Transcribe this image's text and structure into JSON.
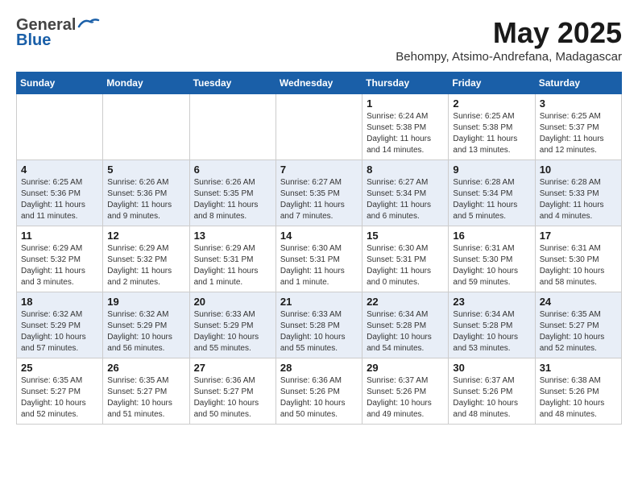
{
  "header": {
    "logo_general": "General",
    "logo_blue": "Blue",
    "month": "May 2025",
    "subtitle": "Behompy, Atsimo-Andrefana, Madagascar"
  },
  "weekdays": [
    "Sunday",
    "Monday",
    "Tuesday",
    "Wednesday",
    "Thursday",
    "Friday",
    "Saturday"
  ],
  "weeks": [
    [
      {
        "day": "",
        "info": ""
      },
      {
        "day": "",
        "info": ""
      },
      {
        "day": "",
        "info": ""
      },
      {
        "day": "",
        "info": ""
      },
      {
        "day": "1",
        "info": "Sunrise: 6:24 AM\nSunset: 5:38 PM\nDaylight: 11 hours\nand 14 minutes."
      },
      {
        "day": "2",
        "info": "Sunrise: 6:25 AM\nSunset: 5:38 PM\nDaylight: 11 hours\nand 13 minutes."
      },
      {
        "day": "3",
        "info": "Sunrise: 6:25 AM\nSunset: 5:37 PM\nDaylight: 11 hours\nand 12 minutes."
      }
    ],
    [
      {
        "day": "4",
        "info": "Sunrise: 6:25 AM\nSunset: 5:36 PM\nDaylight: 11 hours\nand 11 minutes."
      },
      {
        "day": "5",
        "info": "Sunrise: 6:26 AM\nSunset: 5:36 PM\nDaylight: 11 hours\nand 9 minutes."
      },
      {
        "day": "6",
        "info": "Sunrise: 6:26 AM\nSunset: 5:35 PM\nDaylight: 11 hours\nand 8 minutes."
      },
      {
        "day": "7",
        "info": "Sunrise: 6:27 AM\nSunset: 5:35 PM\nDaylight: 11 hours\nand 7 minutes."
      },
      {
        "day": "8",
        "info": "Sunrise: 6:27 AM\nSunset: 5:34 PM\nDaylight: 11 hours\nand 6 minutes."
      },
      {
        "day": "9",
        "info": "Sunrise: 6:28 AM\nSunset: 5:34 PM\nDaylight: 11 hours\nand 5 minutes."
      },
      {
        "day": "10",
        "info": "Sunrise: 6:28 AM\nSunset: 5:33 PM\nDaylight: 11 hours\nand 4 minutes."
      }
    ],
    [
      {
        "day": "11",
        "info": "Sunrise: 6:29 AM\nSunset: 5:32 PM\nDaylight: 11 hours\nand 3 minutes."
      },
      {
        "day": "12",
        "info": "Sunrise: 6:29 AM\nSunset: 5:32 PM\nDaylight: 11 hours\nand 2 minutes."
      },
      {
        "day": "13",
        "info": "Sunrise: 6:29 AM\nSunset: 5:31 PM\nDaylight: 11 hours\nand 1 minute."
      },
      {
        "day": "14",
        "info": "Sunrise: 6:30 AM\nSunset: 5:31 PM\nDaylight: 11 hours\nand 1 minute."
      },
      {
        "day": "15",
        "info": "Sunrise: 6:30 AM\nSunset: 5:31 PM\nDaylight: 11 hours\nand 0 minutes."
      },
      {
        "day": "16",
        "info": "Sunrise: 6:31 AM\nSunset: 5:30 PM\nDaylight: 10 hours\nand 59 minutes."
      },
      {
        "day": "17",
        "info": "Sunrise: 6:31 AM\nSunset: 5:30 PM\nDaylight: 10 hours\nand 58 minutes."
      }
    ],
    [
      {
        "day": "18",
        "info": "Sunrise: 6:32 AM\nSunset: 5:29 PM\nDaylight: 10 hours\nand 57 minutes."
      },
      {
        "day": "19",
        "info": "Sunrise: 6:32 AM\nSunset: 5:29 PM\nDaylight: 10 hours\nand 56 minutes."
      },
      {
        "day": "20",
        "info": "Sunrise: 6:33 AM\nSunset: 5:29 PM\nDaylight: 10 hours\nand 55 minutes."
      },
      {
        "day": "21",
        "info": "Sunrise: 6:33 AM\nSunset: 5:28 PM\nDaylight: 10 hours\nand 55 minutes."
      },
      {
        "day": "22",
        "info": "Sunrise: 6:34 AM\nSunset: 5:28 PM\nDaylight: 10 hours\nand 54 minutes."
      },
      {
        "day": "23",
        "info": "Sunrise: 6:34 AM\nSunset: 5:28 PM\nDaylight: 10 hours\nand 53 minutes."
      },
      {
        "day": "24",
        "info": "Sunrise: 6:35 AM\nSunset: 5:27 PM\nDaylight: 10 hours\nand 52 minutes."
      }
    ],
    [
      {
        "day": "25",
        "info": "Sunrise: 6:35 AM\nSunset: 5:27 PM\nDaylight: 10 hours\nand 52 minutes."
      },
      {
        "day": "26",
        "info": "Sunrise: 6:35 AM\nSunset: 5:27 PM\nDaylight: 10 hours\nand 51 minutes."
      },
      {
        "day": "27",
        "info": "Sunrise: 6:36 AM\nSunset: 5:27 PM\nDaylight: 10 hours\nand 50 minutes."
      },
      {
        "day": "28",
        "info": "Sunrise: 6:36 AM\nSunset: 5:26 PM\nDaylight: 10 hours\nand 50 minutes."
      },
      {
        "day": "29",
        "info": "Sunrise: 6:37 AM\nSunset: 5:26 PM\nDaylight: 10 hours\nand 49 minutes."
      },
      {
        "day": "30",
        "info": "Sunrise: 6:37 AM\nSunset: 5:26 PM\nDaylight: 10 hours\nand 48 minutes."
      },
      {
        "day": "31",
        "info": "Sunrise: 6:38 AM\nSunset: 5:26 PM\nDaylight: 10 hours\nand 48 minutes."
      }
    ]
  ]
}
